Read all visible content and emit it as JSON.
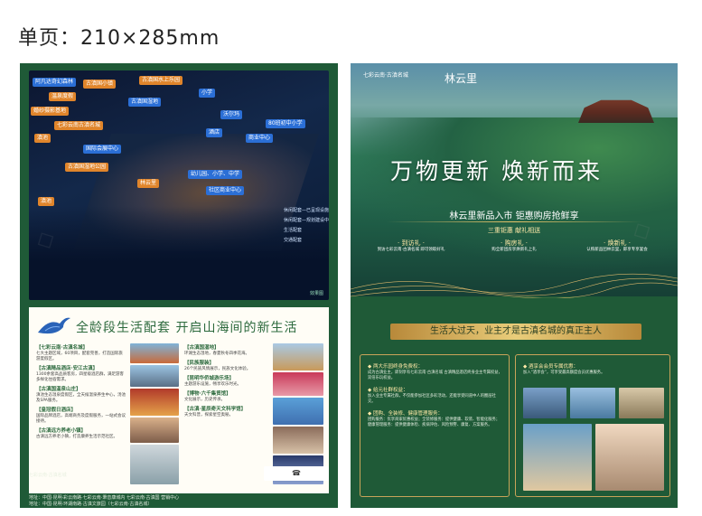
{
  "header": {
    "title": "单页：210×285mm"
  },
  "map": {
    "labels": [
      {
        "text": "阿凡达奇幻森林",
        "color": "b"
      },
      {
        "text": "古滇国小镇",
        "color": "o"
      },
      {
        "text": "古滇国水上乐园",
        "color": "o"
      },
      {
        "text": "温泉度假",
        "color": "o"
      },
      {
        "text": "婚纱摄影基地",
        "color": "o"
      },
      {
        "text": "古滇国湿地",
        "color": "b"
      },
      {
        "text": "七彩云南古滇名城",
        "color": "o"
      },
      {
        "text": "滇池",
        "color": "o"
      },
      {
        "text": "国际会展中心",
        "color": "b"
      },
      {
        "text": "古滇国湿地公园",
        "color": "o"
      },
      {
        "text": "小学",
        "color": "b"
      },
      {
        "text": "沃尔玛",
        "color": "b"
      },
      {
        "text": "酒店",
        "color": "b"
      },
      {
        "text": "商业中心",
        "color": "b"
      },
      {
        "text": "80班初中小学",
        "color": "b"
      },
      {
        "text": "幼儿园、小学、中学",
        "color": "b"
      },
      {
        "text": "社区商业中心",
        "color": "b"
      },
      {
        "text": "林云里",
        "color": "o"
      },
      {
        "text": "滇池",
        "color": "o"
      }
    ],
    "legend": [
      "休闲配套—已呈现设施",
      "休闲配套—规划建设中",
      "生活配套",
      "交通配套"
    ],
    "copyright": "效果图"
  },
  "left_card": {
    "heading": "全龄段生活配套  开启山海间的新生活",
    "col1": [
      {
        "h": "【七彩云南·古滇名城】",
        "d": "七大主题区域，60项目，配套完善，打造国际旅游度假区。"
      },
      {
        "h": "【古滇精品酒店·安江古滇】",
        "d": "1300余套高品质客房，四星级酒店群，满足游客多样化住宿需求。"
      },
      {
        "h": "【古滇国温泉山庄】",
        "d": "滇池生态温泉度假区，全天候温泉养生中心，汤池及SPA服务。"
      },
      {
        "h": "【皇冠假日酒店】",
        "d": "国际品牌酒店，高端商务及度假服务，一站式会议接待。"
      },
      {
        "h": "【古滇远方养老小镇】",
        "d": "古滇远方养老小镇，打造康养生活示范社区。"
      }
    ],
    "col2": [
      {
        "h": "【古滇国湿地】",
        "d": "环湖生态湿地，春夏秋冬四季花海。"
      },
      {
        "h": "【民族服装】",
        "d": "26个民族风情展示，民族文化体验。"
      },
      {
        "h": "【昆明华侨城游乐场】",
        "d": "主题游乐设施，畅享欢乐时光。"
      },
      {
        "h": "【博物·六千集贸馆】",
        "d": "文化展示，历史传承。"
      },
      {
        "h": "【古滇·星辰奇天文科学馆】",
        "d": "天文科普，探索星空奥秘。"
      }
    ],
    "footer1": "地址：中国·昆明·彩云南路·七彩云南·秉音康城内 七彩云南·古滇国 营销中心",
    "footer2": "地址：中国·昆明·环湖南路·古滇文旅园（七彩云南·古滇名城）"
  },
  "right_hero": {
    "logo_text": "七彩云南·古滇名城",
    "brand": "林云里",
    "slogan": "万物更新  焕新而来",
    "sub1": "林云里新品入市 钜惠购房抢鲜享",
    "sub2": "三重钜惠 献礼相送",
    "gifts": [
      {
        "t": "· 到访礼 ·",
        "d": "到访七彩云南·古滇名城 即可领取好礼"
      },
      {
        "t": "· 购房礼 ·",
        "d": "购全新团房享焕新礼上礼"
      },
      {
        "t": "· 焕新礼 ·",
        "d": "认购新品团林云里，即享专享宴会"
      }
    ]
  },
  "right_bottom": {
    "banner": "生活大过天，业主才是古滇名城的真正主人",
    "left_items": [
      {
        "t": "◆ 两大乐园终身免费权：",
        "d": "成为古滇业主，即刻享有七彩云南·古滇名城 古滇精品酒店终身业主专属权益，双倍乐玩权益。"
      },
      {
        "t": "◆ 给元社群权益：",
        "d": "加入业主专属社群，不仅能参加社区多彩活动，还能享受同道中人的圈层社交。"
      },
      {
        "t": "◆ 团购、全装修、健康管理服务：",
        "d": "团购服务：优享商家优惠权益；全装修服务：提供健康、软装、智能化服务；健康管理服务：提供健康体检、疾病评估、风险预警、康复、方案服务。"
      }
    ],
    "right_item": {
      "t": "◆ 酒享会会员专属优惠：",
      "d": "加入“酒享会”，可享受最高额度会员优惠服务。"
    }
  },
  "colors": {
    "panel": "#1f5a37",
    "accent": "#c9a45a"
  }
}
